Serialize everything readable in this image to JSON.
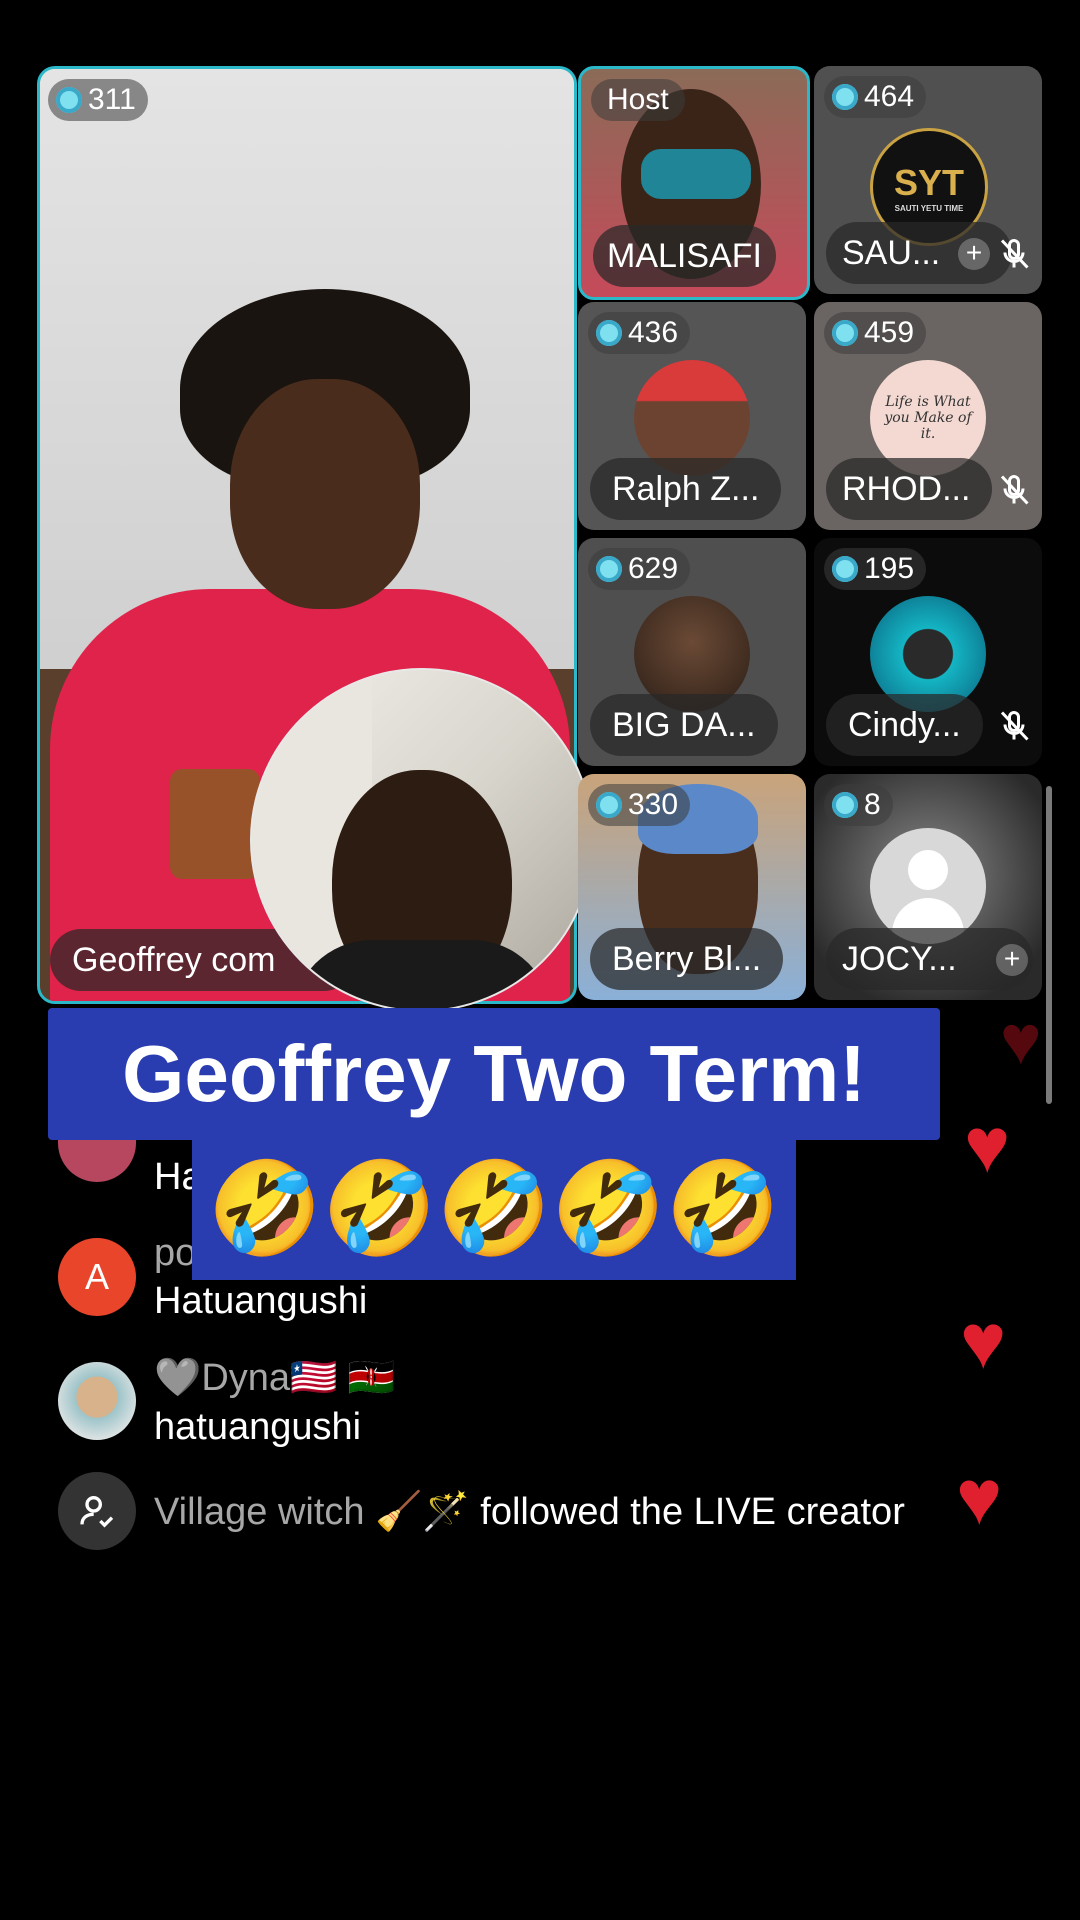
{
  "main_speaker": {
    "gift_count": "311",
    "name": "Geoffrey com"
  },
  "tiles": [
    {
      "id": "malisafi",
      "badge": "Host",
      "name": "MALISAFI"
    },
    {
      "id": "sau",
      "gift_count": "464",
      "name": "SAU...",
      "logo_text": "SYT",
      "logo_sub": "SAUTI YETU TIME",
      "has_add": true,
      "muted": true
    },
    {
      "id": "ralph",
      "gift_count": "436",
      "name": "Ralph Z..."
    },
    {
      "id": "rhod",
      "gift_count": "459",
      "name": "RHOD...",
      "muted": true,
      "pic_text": "Life is What you Make of it."
    },
    {
      "id": "bigda",
      "gift_count": "629",
      "name": "BIG DA..."
    },
    {
      "id": "cindy",
      "gift_count": "195",
      "name": "Cindy...",
      "muted": true
    },
    {
      "id": "berry",
      "gift_count": "330",
      "name": "Berry Bl..."
    },
    {
      "id": "jocy",
      "gift_count": "8",
      "name": "JOCY...",
      "has_add": true
    }
  ],
  "title_overlay": {
    "line1": "Geoffrey Two Term!",
    "line2": "🤣🤣🤣🤣🤣"
  },
  "comments": [
    {
      "avatar_letter": "",
      "username": "",
      "text": "Ha"
    },
    {
      "avatar_letter": "A",
      "avatar_color": "#e8452a",
      "username": "po",
      "text": "Hatuangushi"
    },
    {
      "avatar_letter": "",
      "username": "🩶Dyna🇱🇷 🇰🇪",
      "text": "hatuangushi"
    },
    {
      "username": "Village witch 🧹🪄",
      "text": " followed the LIVE creator"
    }
  ],
  "colors": {
    "host_border": "#2bb8c9",
    "banner_blue": "#2a3db0",
    "heart_red": "#e0202e"
  }
}
